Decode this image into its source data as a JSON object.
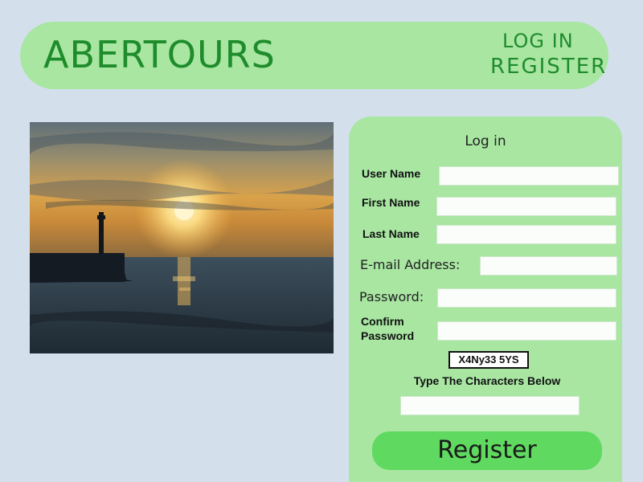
{
  "header": {
    "brand": "ABERTOURS",
    "login_link": "LOG IN",
    "register_link": "REGISTER"
  },
  "hero_image": {
    "description": "sunset-over-sea-with-lighthouse"
  },
  "form": {
    "title": "Log in",
    "fields": {
      "username": {
        "label": "User Name",
        "value": ""
      },
      "first_name": {
        "label": "First Name",
        "value": ""
      },
      "last_name": {
        "label": "Last Name",
        "value": ""
      },
      "email": {
        "label": "E-mail Address:",
        "value": ""
      },
      "password": {
        "label": "Password:",
        "value": ""
      },
      "confirm_password": {
        "label_line1": "Confirm",
        "label_line2": "Password",
        "value": ""
      }
    },
    "captcha": {
      "code": "X4Ny33 5YS",
      "hint": "Type The Characters Below",
      "value": ""
    },
    "submit_label": "Register"
  },
  "colors": {
    "page_background": "#d3e0ec",
    "panel_green": "#a8e6a2",
    "brand_green": "#1f8c2c",
    "button_green": "#5fd95f"
  }
}
